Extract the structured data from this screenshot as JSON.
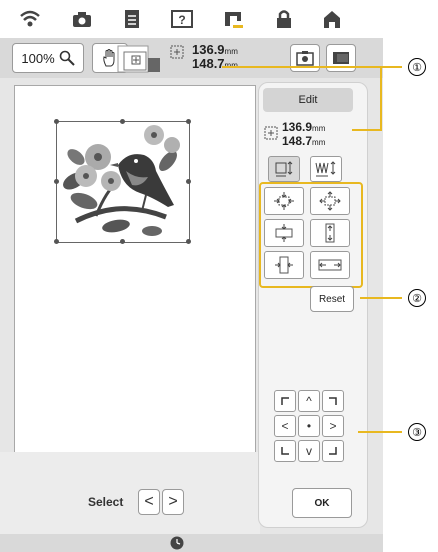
{
  "toolbar": {
    "zoom_label": "100%",
    "size_width": "136.9",
    "size_height": "148.7",
    "unit": "mm"
  },
  "panel": {
    "edit_label": "Edit",
    "size_width": "136.9",
    "size_height": "148.7",
    "unit": "mm",
    "reset_label": "Reset",
    "ok_label": "OK"
  },
  "footer": {
    "select_label": "Select",
    "prev_glyph": "<",
    "next_glyph": ">"
  },
  "move_pad": {
    "up": "^",
    "down": "v",
    "left": "<",
    "right": ">",
    "center": "•"
  },
  "callouts": [
    "①",
    "②",
    "③"
  ],
  "colors": {
    "highlight": "#e8b820",
    "panel_bg": "#f4f4f4",
    "screen_bg": "#e6e6e6"
  },
  "icons": [
    "wifi-icon",
    "camera-icon",
    "document-icon",
    "help-icon",
    "sewing-machine-icon",
    "lock-icon",
    "home-icon",
    "zoom-icon",
    "hand-icon",
    "clock-icon"
  ]
}
